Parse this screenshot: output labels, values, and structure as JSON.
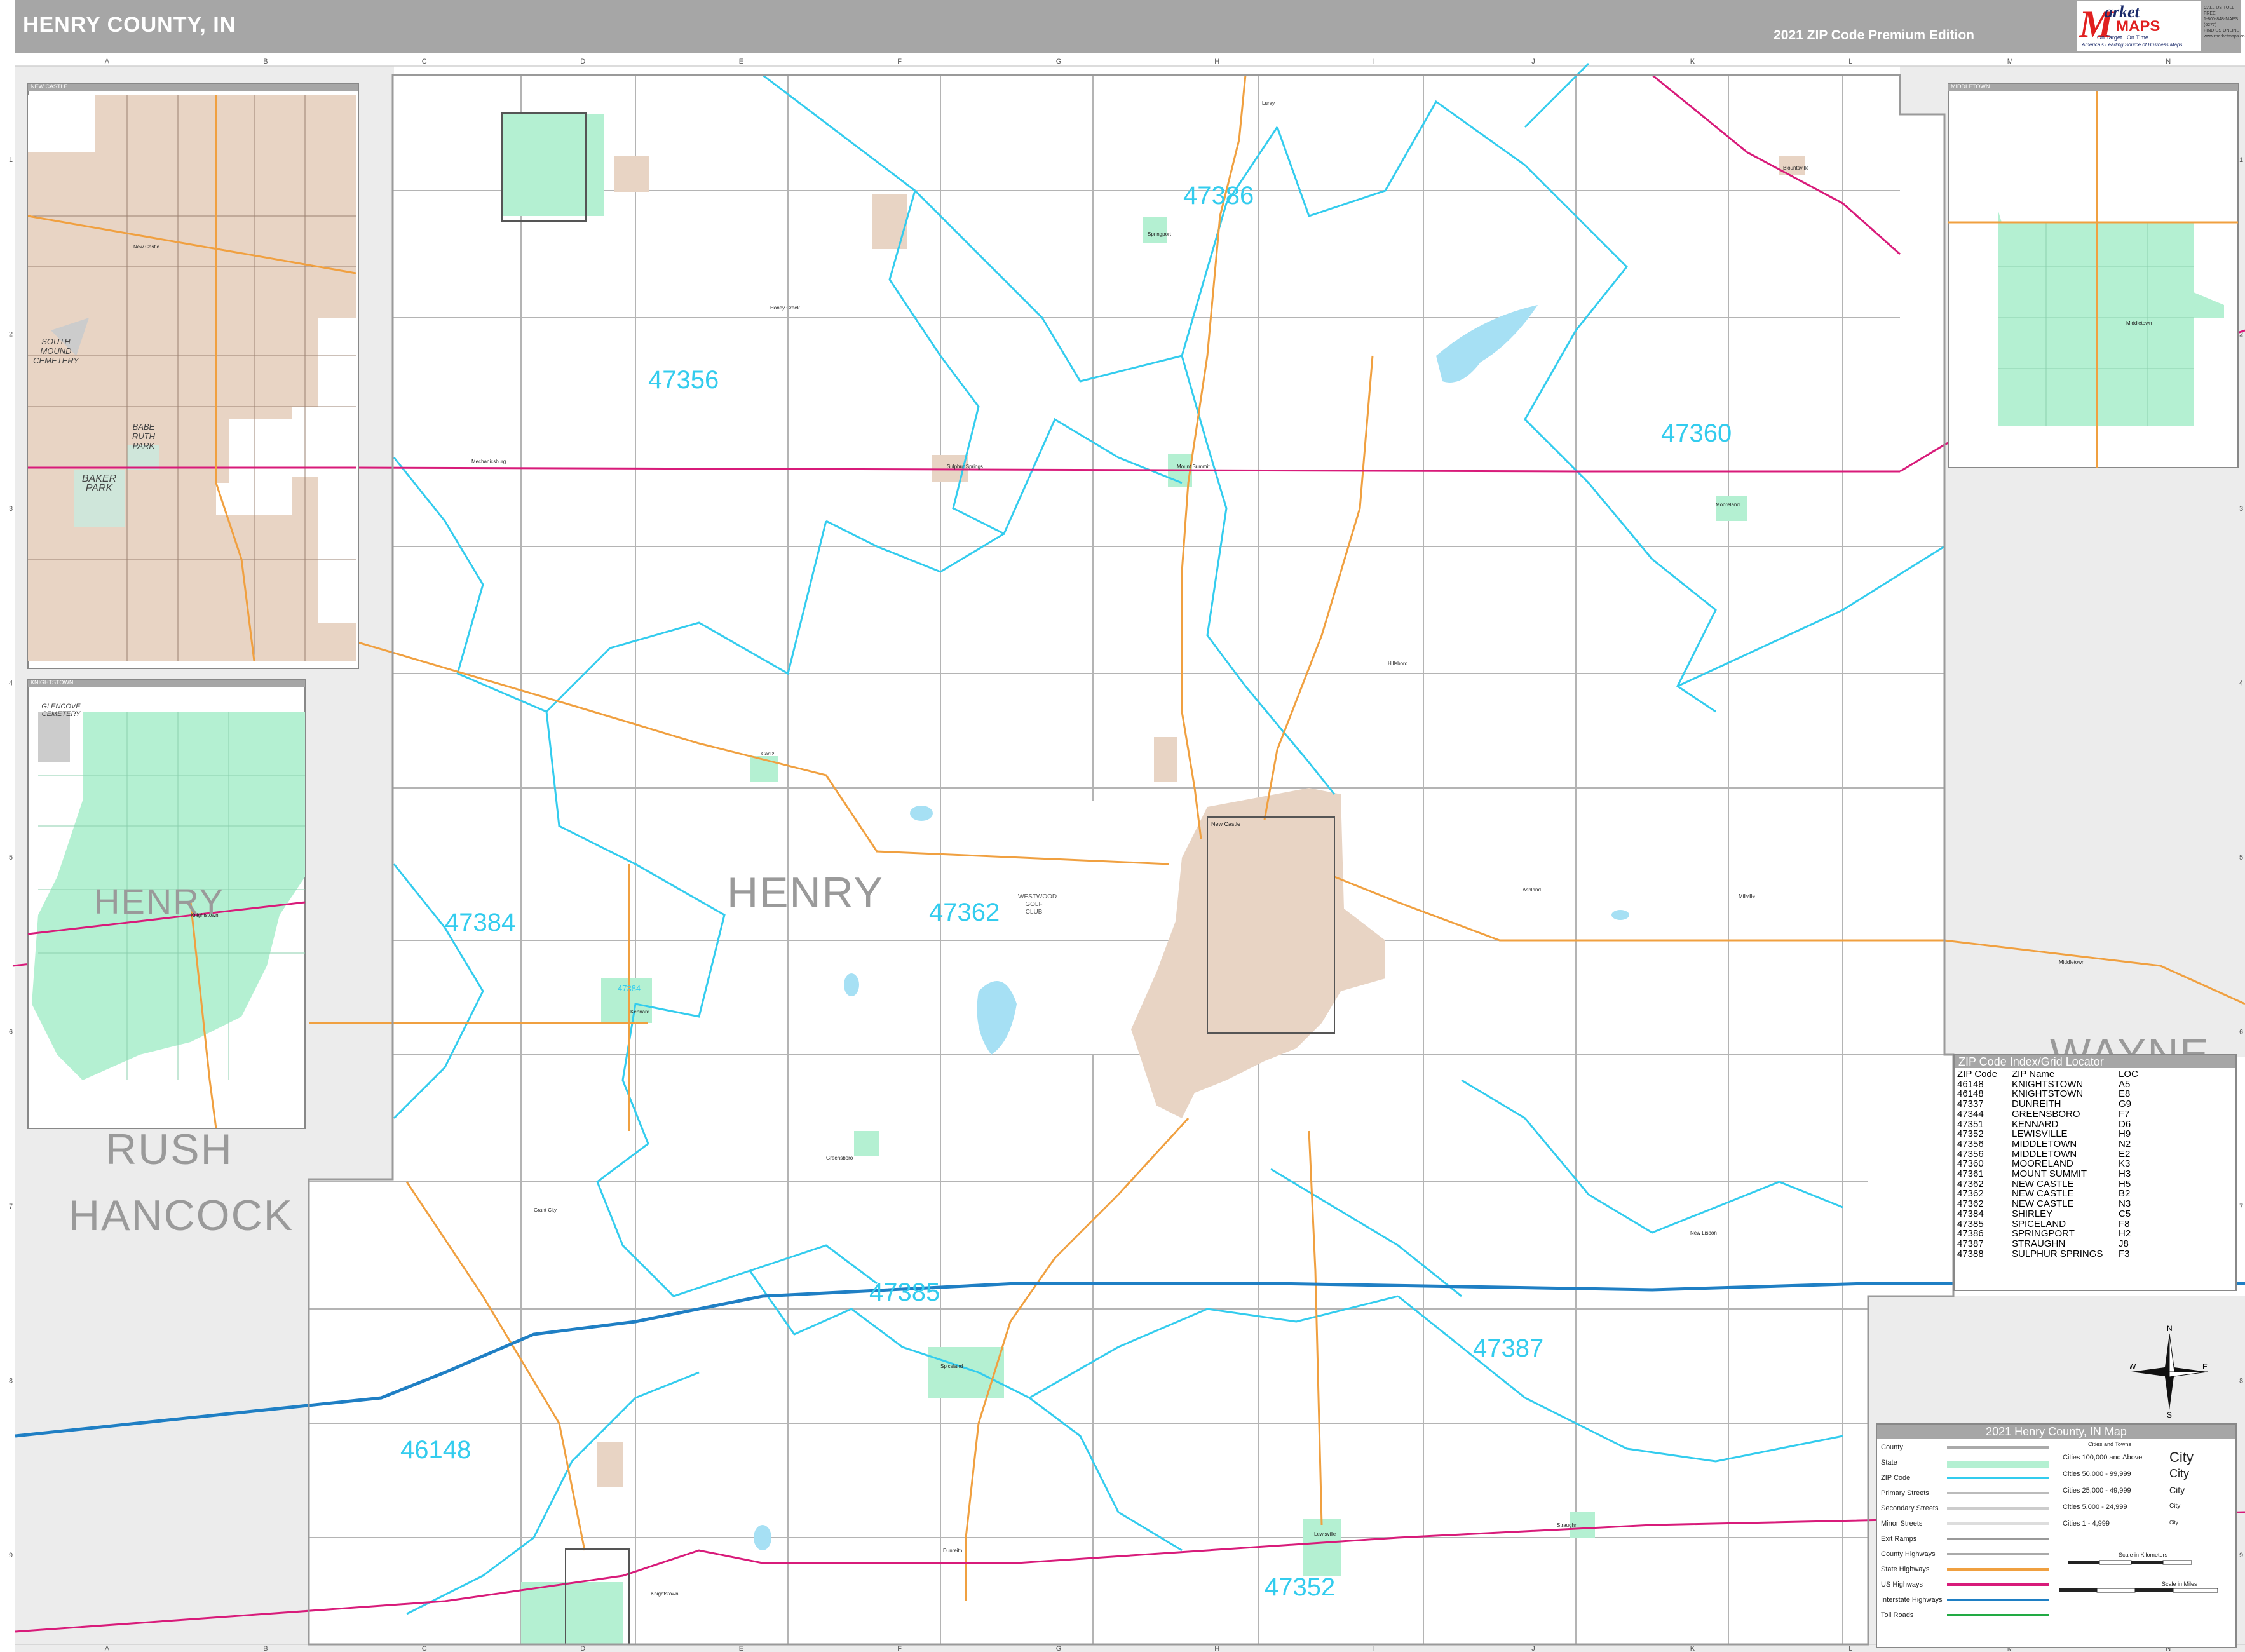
{
  "header": {
    "title": "HENRY COUNTY, IN",
    "edition": "2021 ZIP Code Premium Edition",
    "logo_letter": "M",
    "logo_market": "arket",
    "logo_maps": "MAPS",
    "logo_tagline": "On Target.. On Time.",
    "logo_tagline2": "America's Leading Source of Business Maps",
    "contact": [
      "CALL US TOLL FREE",
      "1-800-848-MAPS (6277)",
      "FIND US ONLINE",
      "www.marketmaps.com"
    ]
  },
  "grid": {
    "columns": [
      "A",
      "B",
      "C",
      "D",
      "E",
      "F",
      "G",
      "H",
      "I",
      "J",
      "K",
      "L",
      "M",
      "N"
    ],
    "rows": [
      "1",
      "2",
      "3",
      "4",
      "5",
      "6",
      "7",
      "8",
      "9"
    ]
  },
  "counties": {
    "henry": "HENRY",
    "rush": "RUSH",
    "hancock": "HANCOCK",
    "wayne": "WAYNE"
  },
  "zip_labels": [
    "47386",
    "47356",
    "47360",
    "47384",
    "47362",
    "47385",
    "47387",
    "46148",
    "47352"
  ],
  "insets": {
    "new_castle": {
      "title": "NEW CASTLE",
      "labels": [
        "SOUTH MOUND CEMETERY",
        "BABE RUTH PARK",
        "BAKER PARK"
      ],
      "town": "New Castle"
    },
    "knightstown": {
      "title": "KNIGHTSTOWN",
      "labels": [
        "GLENCOVE CEMETERY"
      ],
      "county": "HENRY",
      "town": "Knightstown"
    },
    "middletown": {
      "title": "MIDDLETOWN",
      "town": "Middletown"
    }
  },
  "places": {
    "westwood_golf_club": "WESTWOOD GOLF CLUB",
    "new_castle": "New Castle",
    "middletown": "Middletown",
    "mooreland": "Mooreland",
    "sulphur_springs": "Sulphur Springs",
    "mount_summit": "Mount Summit",
    "spiceland": "Spiceland",
    "dunreith": "Dunreith",
    "lewisville": "Lewisville",
    "greensboro": "Greensboro",
    "kennard": "Kennard",
    "shirley": "Shirley",
    "springport": "Springport",
    "straughn": "Straughn",
    "knightstown": "Knightstown",
    "mechanicsburg": "Mechanicsburg",
    "cadiz": "Cadiz",
    "blountsville": "Blountsville",
    "new_lisbon": "New Lisbon",
    "grant_city": "Grant City",
    "hillsboro": "Hillsboro",
    "ashland": "Ashland",
    "millville": "Millville",
    "luray": "Luray",
    "honey_creek": "Honey Creek",
    "shirley_zip_box": "47384"
  },
  "zip_index": {
    "title": "ZIP Code Index/Grid Locator",
    "headers": [
      "ZIP Code",
      "ZIP Name",
      "LOC"
    ],
    "rows": [
      [
        "46148",
        "KNIGHTSTOWN",
        "A5"
      ],
      [
        "46148",
        "KNIGHTSTOWN",
        "E8"
      ],
      [
        "47337",
        "DUNREITH",
        "G9"
      ],
      [
        "47344",
        "GREENSBORO",
        "F7"
      ],
      [
        "47351",
        "KENNARD",
        "D6"
      ],
      [
        "47352",
        "LEWISVILLE",
        "H9"
      ],
      [
        "47356",
        "MIDDLETOWN",
        "N2"
      ],
      [
        "47356",
        "MIDDLETOWN",
        "E2"
      ],
      [
        "47360",
        "MOORELAND",
        "K3"
      ],
      [
        "47361",
        "MOUNT SUMMIT",
        "H3"
      ],
      [
        "47362",
        "NEW CASTLE",
        "H5"
      ],
      [
        "47362",
        "NEW CASTLE",
        "B2"
      ],
      [
        "47362",
        "NEW CASTLE",
        "N3"
      ],
      [
        "47384",
        "SHIRLEY",
        "C5"
      ],
      [
        "47385",
        "SPICELAND",
        "F8"
      ],
      [
        "47386",
        "SPRINGPORT",
        "H2"
      ],
      [
        "47387",
        "STRAUGHN",
        "J8"
      ],
      [
        "47388",
        "SULPHUR SPRINGS",
        "F3"
      ]
    ]
  },
  "legend": {
    "title": "2021 Henry County, IN Map",
    "rows": [
      "County",
      "State",
      "ZIP Code",
      "Primary Streets",
      "Secondary Streets",
      "Minor Streets",
      "Exit Ramps",
      "County Highways",
      "State Highways",
      "US Highways",
      "Interstate Highways",
      "Toll Roads"
    ],
    "cities_header": "Cities and Towns",
    "city_rows": [
      {
        "label": "Cities 100,000 and Above",
        "sample": "City"
      },
      {
        "label": "Cities 50,000 - 99,999",
        "sample": "City"
      },
      {
        "label": "Cities 25,000 - 49,999",
        "sample": "City"
      },
      {
        "label": "Cities 5,000 - 24,999",
        "sample": "City"
      },
      {
        "label": "Cities 1 - 4,999",
        "sample": "City"
      }
    ],
    "scale_km": "Scale in Kilometers",
    "scale_mi": "Scale in Miles"
  },
  "compass": {
    "n": "N",
    "s": "S",
    "e": "E",
    "w": "W"
  },
  "colors": {
    "zip_boundary": "#33ccee",
    "interstate": "#1f7fc4",
    "us_highway": "#d81b7a",
    "state_highway": "#f0a040",
    "urban_area": "#e8d4c4",
    "green_city": "#b4f0d2",
    "header_gray": "#a6a6a6",
    "inset_gray": "#e8e8e8"
  }
}
